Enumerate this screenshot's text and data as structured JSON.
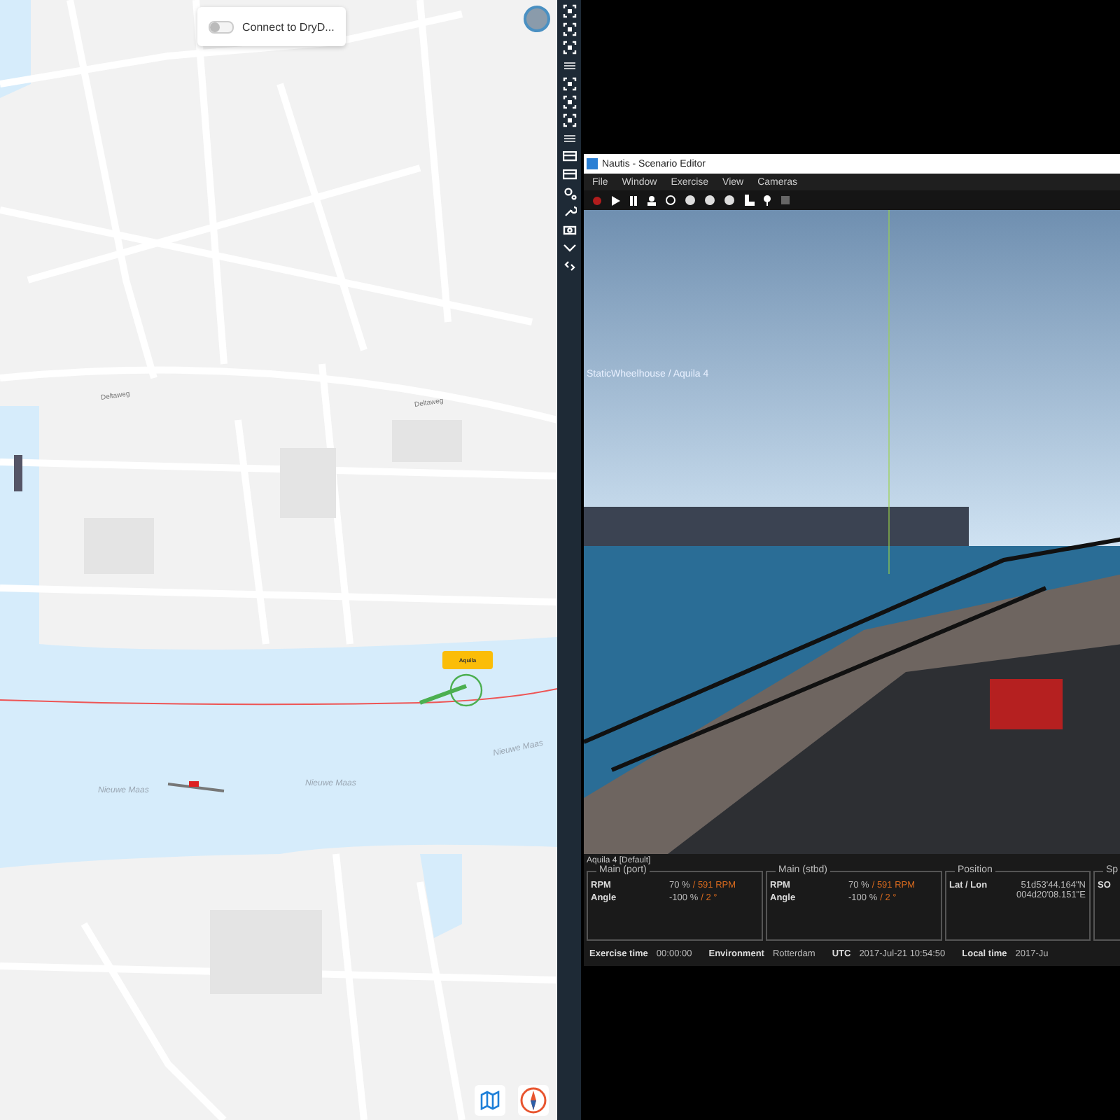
{
  "map": {
    "connect_toggle": {
      "label": "Connect to DryD...",
      "on": false
    },
    "labels": [
      {
        "text": "Deltaweg",
        "kind": "street"
      },
      {
        "text": "Deltaweg",
        "kind": "street"
      },
      {
        "text": "Nieuwe Maas",
        "kind": "water"
      },
      {
        "text": "Nieuwe Maas",
        "kind": "water"
      },
      {
        "text": "Nieuwe Maas",
        "kind": "water"
      }
    ],
    "ship_label": "Aquila"
  },
  "window": {
    "title": "Nautis - Scenario Editor",
    "menu": [
      "File",
      "Window",
      "Exercise",
      "View",
      "Cameras"
    ],
    "view_caption": "StaticWheelhouse / Aquila 4",
    "info_title": "Aquila 4 [Default]",
    "panels": [
      {
        "title": "Main (port)",
        "rows": [
          {
            "label": "RPM",
            "value": "70 %",
            "extra": "/ 591 RPM"
          },
          {
            "label": "Angle",
            "value": "-100 %",
            "extra": "/ 2 °"
          }
        ]
      },
      {
        "title": "Main (stbd)",
        "rows": [
          {
            "label": "RPM",
            "value": "70 %",
            "extra": "/ 591 RPM"
          },
          {
            "label": "Angle",
            "value": "-100 %",
            "extra": "/ 2 °"
          }
        ]
      },
      {
        "title": "Position",
        "kind": "stacked",
        "rows": [
          {
            "label": "Lat / Lon",
            "value": "51d53'44.164\"N",
            "extra": "004d20'08.151\"E"
          }
        ]
      },
      {
        "title": "Sp",
        "rows": [
          {
            "label": "SO",
            "value": "",
            "extra": ""
          }
        ]
      }
    ],
    "status": [
      {
        "label": "Exercise time",
        "value": "00:00:00"
      },
      {
        "label": "Environment",
        "value": "Rotterdam"
      },
      {
        "label": "UTC",
        "value": "2017-Jul-21 10:54:50"
      },
      {
        "label": "Local time",
        "value": "2017-Ju"
      }
    ]
  }
}
